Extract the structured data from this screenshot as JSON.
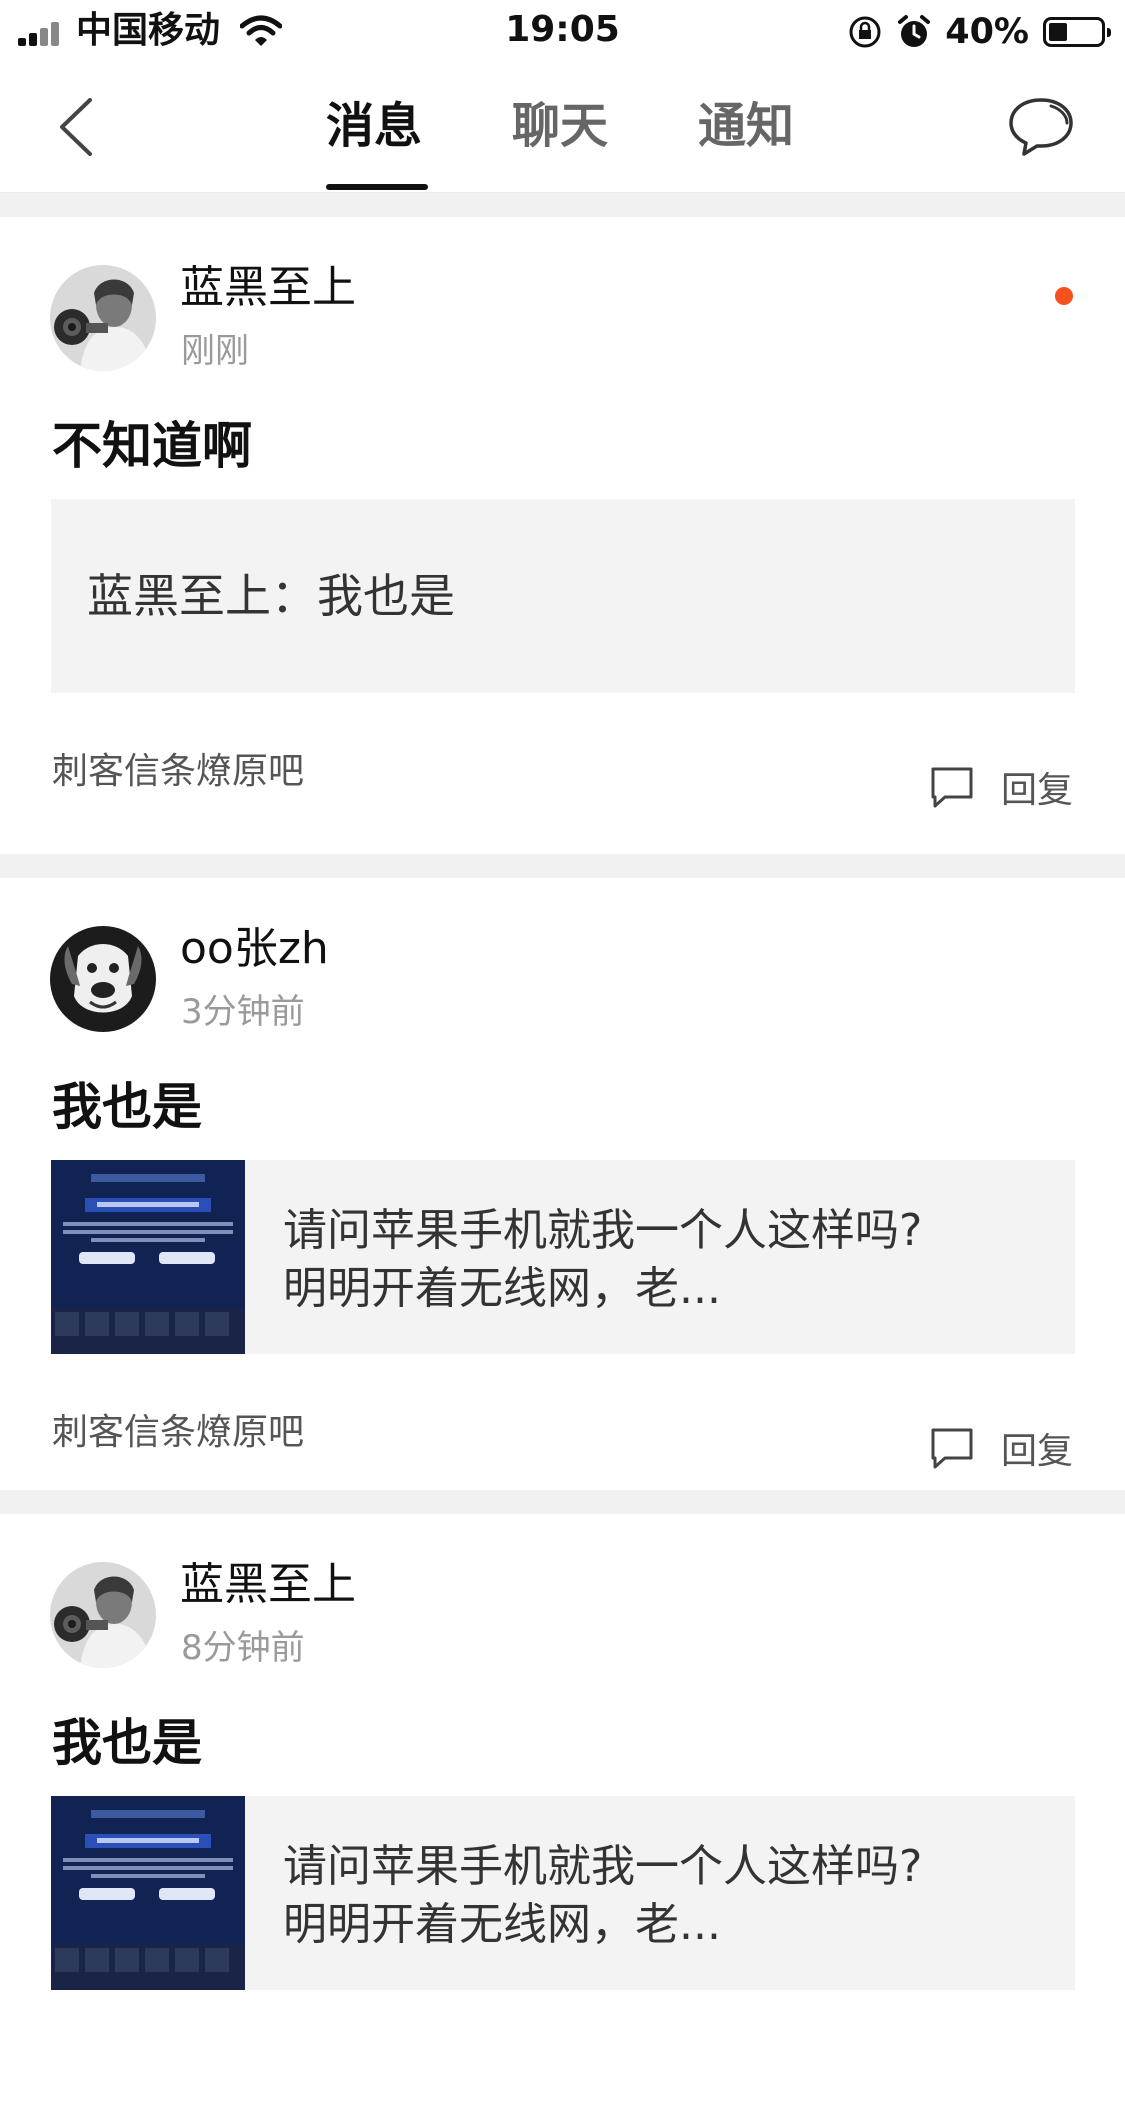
{
  "status_bar": {
    "carrier": "中国移动",
    "time": "19:05",
    "battery": "40%",
    "battery_level": 0.4
  },
  "nav": {
    "tabs": [
      {
        "label": "消息",
        "active": true
      },
      {
        "label": "聊天",
        "active": false
      },
      {
        "label": "通知",
        "active": false
      }
    ]
  },
  "items": [
    {
      "author": "蓝黑至上",
      "time": "刚刚",
      "unread": true,
      "body": "不知道啊",
      "quote": "蓝黑至上：我也是",
      "forum": "刺客信条燎原吧",
      "reply_label": "回复"
    },
    {
      "author": "oo张zh",
      "time": "3分钟前",
      "unread": false,
      "body": "我也是",
      "excerpt_line1": "请问苹果手机就我一个人这样吗?",
      "excerpt_line2": "明明开着无线网，老...",
      "forum": "刺客信条燎原吧",
      "reply_label": "回复"
    },
    {
      "author": "蓝黑至上",
      "time": "8分钟前",
      "unread": false,
      "body": "我也是",
      "excerpt_line1": "请问苹果手机就我一个人这样吗?",
      "excerpt_line2": "明明开着无线网，老..."
    }
  ],
  "colors": {
    "accent_dot": "#f4511e",
    "divider": "#f1f1f1",
    "quote_bg": "#f3f3f3"
  }
}
